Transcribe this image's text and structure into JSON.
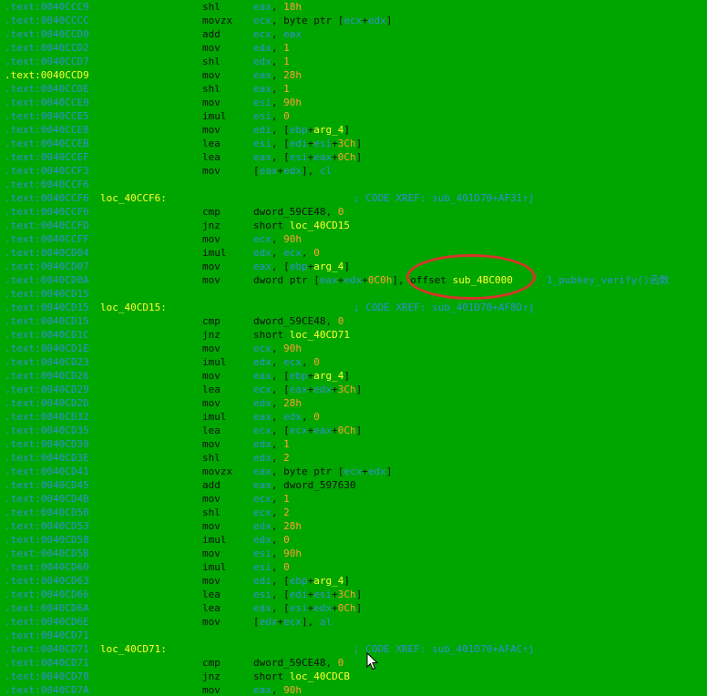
{
  "listing": {
    "lines": [
      {
        "addr": ".text:0040CCC9",
        "mn": "shl",
        "ops": [
          [
            "r",
            "eax"
          ],
          [
            "d",
            ", "
          ],
          [
            "n",
            "18h"
          ]
        ]
      },
      {
        "addr": ".text:0040CCCC",
        "mn": "movzx",
        "ops": [
          [
            "r",
            "ecx"
          ],
          [
            "d",
            ", byte ptr ["
          ],
          [
            "r",
            "ecx"
          ],
          [
            "d",
            "+"
          ],
          [
            "r",
            "edx"
          ],
          [
            "d",
            "]"
          ]
        ]
      },
      {
        "addr": ".text:0040CCD0",
        "mn": "add",
        "ops": [
          [
            "r",
            "ecx"
          ],
          [
            "d",
            ", "
          ],
          [
            "r",
            "eax"
          ]
        ]
      },
      {
        "addr": ".text:0040CCD2",
        "mn": "mov",
        "ops": [
          [
            "r",
            "edx"
          ],
          [
            "d",
            ", "
          ],
          [
            "n",
            "1"
          ]
        ]
      },
      {
        "addr": ".text:0040CCD7",
        "mn": "shl",
        "ops": [
          [
            "r",
            "edx"
          ],
          [
            "d",
            ", "
          ],
          [
            "n",
            "1"
          ]
        ]
      },
      {
        "addr": ".text:0040CCD9",
        "hl": true,
        "mn": "mov",
        "ops": [
          [
            "r",
            "eax"
          ],
          [
            "d",
            ", "
          ],
          [
            "n",
            "28h"
          ]
        ]
      },
      {
        "addr": ".text:0040CCDE",
        "mn": "shl",
        "ops": [
          [
            "r",
            "eax"
          ],
          [
            "d",
            ", "
          ],
          [
            "n",
            "1"
          ]
        ]
      },
      {
        "addr": ".text:0040CCE0",
        "mn": "mov",
        "ops": [
          [
            "r",
            "esi"
          ],
          [
            "d",
            ", "
          ],
          [
            "n",
            "90h"
          ]
        ]
      },
      {
        "addr": ".text:0040CCE5",
        "mn": "imul",
        "ops": [
          [
            "r",
            "esi"
          ],
          [
            "d",
            ", "
          ],
          [
            "n",
            "0"
          ]
        ]
      },
      {
        "addr": ".text:0040CCE8",
        "mn": "mov",
        "ops": [
          [
            "r",
            "edi"
          ],
          [
            "d",
            ", ["
          ],
          [
            "r",
            "ebp"
          ],
          [
            "d",
            "+"
          ],
          [
            "y",
            "arg_4"
          ],
          [
            "d",
            "]"
          ]
        ]
      },
      {
        "addr": ".text:0040CCEB",
        "mn": "lea",
        "ops": [
          [
            "r",
            "esi"
          ],
          [
            "d",
            ", ["
          ],
          [
            "r",
            "edi"
          ],
          [
            "d",
            "+"
          ],
          [
            "r",
            "esi"
          ],
          [
            "d",
            "+"
          ],
          [
            "n",
            "3Ch"
          ],
          [
            "d",
            "]"
          ]
        ]
      },
      {
        "addr": ".text:0040CCEF",
        "mn": "lea",
        "ops": [
          [
            "r",
            "eax"
          ],
          [
            "d",
            ", ["
          ],
          [
            "r",
            "esi"
          ],
          [
            "d",
            "+"
          ],
          [
            "r",
            "eax"
          ],
          [
            "d",
            "+"
          ],
          [
            "n",
            "0Ch"
          ],
          [
            "d",
            "]"
          ]
        ]
      },
      {
        "addr": ".text:0040CCF3",
        "mn": "mov",
        "ops": [
          [
            "d",
            "["
          ],
          [
            "r",
            "eax"
          ],
          [
            "d",
            "+"
          ],
          [
            "r",
            "edx"
          ],
          [
            "d",
            "], "
          ],
          [
            "r",
            "cl"
          ]
        ]
      },
      {
        "addr": ".text:0040CCF6"
      },
      {
        "addr": ".text:0040CCF6",
        "label": "loc_40CCF6:",
        "comment": "; CODE XREF: sub_401D70+AF31↑j"
      },
      {
        "addr": ".text:0040CCF6",
        "mn": "cmp",
        "ops": [
          [
            "d",
            "dword_59CE48, "
          ],
          [
            "n",
            "0"
          ]
        ]
      },
      {
        "addr": ".text:0040CCFD",
        "mn": "jnz",
        "ops": [
          [
            "d",
            "short "
          ],
          [
            "y",
            "loc_40CD15"
          ]
        ]
      },
      {
        "addr": ".text:0040CCFF",
        "mn": "mov",
        "ops": [
          [
            "r",
            "ecx"
          ],
          [
            "d",
            ", "
          ],
          [
            "n",
            "90h"
          ]
        ]
      },
      {
        "addr": ".text:0040CD04",
        "mn": "imul",
        "ops": [
          [
            "r",
            "edx"
          ],
          [
            "d",
            ", "
          ],
          [
            "r",
            "ecx"
          ],
          [
            "d",
            ", "
          ],
          [
            "n",
            "0"
          ]
        ]
      },
      {
        "addr": ".text:0040CD07",
        "mn": "mov",
        "ops": [
          [
            "r",
            "eax"
          ],
          [
            "d",
            ", ["
          ],
          [
            "r",
            "ebp"
          ],
          [
            "d",
            "+"
          ],
          [
            "y",
            "arg_4"
          ],
          [
            "d",
            "]"
          ]
        ]
      },
      {
        "addr": ".text:0040CD0A",
        "mn": "mov",
        "ops": [
          [
            "d",
            "dword ptr ["
          ],
          [
            "r",
            "eax"
          ],
          [
            "d",
            "+"
          ],
          [
            "r",
            "edx"
          ],
          [
            "d",
            "+"
          ],
          [
            "n",
            "0C0h"
          ],
          [
            "d",
            "], offset "
          ],
          [
            "y",
            "sub_4BC000"
          ]
        ],
        "comment2": "1_pubkey_verify()函数"
      },
      {
        "addr": ".text:0040CD15"
      },
      {
        "addr": ".text:0040CD15",
        "label": "loc_40CD15:",
        "comment": "; CODE XREF: sub_401D70+AF8D↑j"
      },
      {
        "addr": ".text:0040CD15",
        "mn": "cmp",
        "ops": [
          [
            "d",
            "dword_59CE48, "
          ],
          [
            "n",
            "0"
          ]
        ]
      },
      {
        "addr": ".text:0040CD1C",
        "mn": "jnz",
        "ops": [
          [
            "d",
            "short "
          ],
          [
            "y",
            "loc_40CD71"
          ]
        ]
      },
      {
        "addr": ".text:0040CD1E",
        "mn": "mov",
        "ops": [
          [
            "r",
            "ecx"
          ],
          [
            "d",
            ", "
          ],
          [
            "n",
            "90h"
          ]
        ]
      },
      {
        "addr": ".text:0040CD23",
        "mn": "imul",
        "ops": [
          [
            "r",
            "edx"
          ],
          [
            "d",
            ", "
          ],
          [
            "r",
            "ecx"
          ],
          [
            "d",
            ", "
          ],
          [
            "n",
            "0"
          ]
        ]
      },
      {
        "addr": ".text:0040CD26",
        "mn": "mov",
        "ops": [
          [
            "r",
            "eax"
          ],
          [
            "d",
            ", ["
          ],
          [
            "r",
            "ebp"
          ],
          [
            "d",
            "+"
          ],
          [
            "y",
            "arg_4"
          ],
          [
            "d",
            "]"
          ]
        ]
      },
      {
        "addr": ".text:0040CD29",
        "mn": "lea",
        "ops": [
          [
            "r",
            "ecx"
          ],
          [
            "d",
            ", ["
          ],
          [
            "r",
            "eax"
          ],
          [
            "d",
            "+"
          ],
          [
            "r",
            "edx"
          ],
          [
            "d",
            "+"
          ],
          [
            "n",
            "3Ch"
          ],
          [
            "d",
            "]"
          ]
        ]
      },
      {
        "addr": ".text:0040CD2D",
        "mn": "mov",
        "ops": [
          [
            "r",
            "edx"
          ],
          [
            "d",
            ", "
          ],
          [
            "n",
            "28h"
          ]
        ]
      },
      {
        "addr": ".text:0040CD32",
        "mn": "imul",
        "ops": [
          [
            "r",
            "eax"
          ],
          [
            "d",
            ", "
          ],
          [
            "r",
            "edx"
          ],
          [
            "d",
            ", "
          ],
          [
            "n",
            "0"
          ]
        ]
      },
      {
        "addr": ".text:0040CD35",
        "mn": "lea",
        "ops": [
          [
            "r",
            "ecx"
          ],
          [
            "d",
            ", ["
          ],
          [
            "r",
            "ecx"
          ],
          [
            "d",
            "+"
          ],
          [
            "r",
            "eax"
          ],
          [
            "d",
            "+"
          ],
          [
            "n",
            "0Ch"
          ],
          [
            "d",
            "]"
          ]
        ]
      },
      {
        "addr": ".text:0040CD39",
        "mn": "mov",
        "ops": [
          [
            "r",
            "edx"
          ],
          [
            "d",
            ", "
          ],
          [
            "n",
            "1"
          ]
        ]
      },
      {
        "addr": ".text:0040CD3E",
        "mn": "shl",
        "ops": [
          [
            "r",
            "edx"
          ],
          [
            "d",
            ", "
          ],
          [
            "n",
            "2"
          ]
        ]
      },
      {
        "addr": ".text:0040CD41",
        "mn": "movzx",
        "ops": [
          [
            "r",
            "eax"
          ],
          [
            "d",
            ", byte ptr ["
          ],
          [
            "r",
            "ecx"
          ],
          [
            "d",
            "+"
          ],
          [
            "r",
            "edx"
          ],
          [
            "d",
            "]"
          ]
        ]
      },
      {
        "addr": ".text:0040CD45",
        "mn": "add",
        "ops": [
          [
            "r",
            "eax"
          ],
          [
            "d",
            ", dword_597630"
          ]
        ]
      },
      {
        "addr": ".text:0040CD4B",
        "mn": "mov",
        "ops": [
          [
            "r",
            "ecx"
          ],
          [
            "d",
            ", "
          ],
          [
            "n",
            "1"
          ]
        ]
      },
      {
        "addr": ".text:0040CD50",
        "mn": "shl",
        "ops": [
          [
            "r",
            "ecx"
          ],
          [
            "d",
            ", "
          ],
          [
            "n",
            "2"
          ]
        ]
      },
      {
        "addr": ".text:0040CD53",
        "mn": "mov",
        "ops": [
          [
            "r",
            "edx"
          ],
          [
            "d",
            ", "
          ],
          [
            "n",
            "28h"
          ]
        ]
      },
      {
        "addr": ".text:0040CD58",
        "mn": "imul",
        "ops": [
          [
            "r",
            "edx"
          ],
          [
            "d",
            ", "
          ],
          [
            "n",
            "0"
          ]
        ]
      },
      {
        "addr": ".text:0040CD5B",
        "mn": "mov",
        "ops": [
          [
            "r",
            "esi"
          ],
          [
            "d",
            ", "
          ],
          [
            "n",
            "90h"
          ]
        ]
      },
      {
        "addr": ".text:0040CD60",
        "mn": "imul",
        "ops": [
          [
            "r",
            "esi"
          ],
          [
            "d",
            ", "
          ],
          [
            "n",
            "0"
          ]
        ]
      },
      {
        "addr": ".text:0040CD63",
        "mn": "mov",
        "ops": [
          [
            "r",
            "edi"
          ],
          [
            "d",
            ", ["
          ],
          [
            "r",
            "ebp"
          ],
          [
            "d",
            "+"
          ],
          [
            "y",
            "arg_4"
          ],
          [
            "d",
            "]"
          ]
        ]
      },
      {
        "addr": ".text:0040CD66",
        "mn": "lea",
        "ops": [
          [
            "r",
            "esi"
          ],
          [
            "d",
            ", ["
          ],
          [
            "r",
            "edi"
          ],
          [
            "d",
            "+"
          ],
          [
            "r",
            "esi"
          ],
          [
            "d",
            "+"
          ],
          [
            "n",
            "3Ch"
          ],
          [
            "d",
            "]"
          ]
        ]
      },
      {
        "addr": ".text:0040CD6A",
        "mn": "lea",
        "ops": [
          [
            "r",
            "edx"
          ],
          [
            "d",
            ", ["
          ],
          [
            "r",
            "esi"
          ],
          [
            "d",
            "+"
          ],
          [
            "r",
            "edx"
          ],
          [
            "d",
            "+"
          ],
          [
            "n",
            "0Ch"
          ],
          [
            "d",
            "]"
          ]
        ]
      },
      {
        "addr": ".text:0040CD6E",
        "mn": "mov",
        "ops": [
          [
            "d",
            "["
          ],
          [
            "r",
            "edx"
          ],
          [
            "d",
            "+"
          ],
          [
            "r",
            "ecx"
          ],
          [
            "d",
            "], "
          ],
          [
            "r",
            "al"
          ]
        ]
      },
      {
        "addr": ".text:0040CD71"
      },
      {
        "addr": ".text:0040CD71",
        "label": "loc_40CD71:",
        "comment": "; CODE XREF: sub_401D70+AFAC↑j"
      },
      {
        "addr": ".text:0040CD71",
        "mn": "cmp",
        "ops": [
          [
            "d",
            "dword_59CE48, "
          ],
          [
            "n",
            "0"
          ]
        ]
      },
      {
        "addr": ".text:0040CD78",
        "mn": "jnz",
        "ops": [
          [
            "d",
            "short "
          ],
          [
            "y",
            "loc_40CDCB"
          ]
        ]
      },
      {
        "addr": ".text:0040CD7A",
        "mn": "mov",
        "ops": [
          [
            "r",
            "eax"
          ],
          [
            "d",
            ", "
          ],
          [
            "n",
            "90h"
          ]
        ]
      }
    ]
  },
  "colors": {
    "background": "#00a600",
    "address": "#2f8fd0",
    "label": "#ffff33",
    "number": "#ffa033",
    "register": "#2f8fd0",
    "annotation": "#d8352a"
  }
}
